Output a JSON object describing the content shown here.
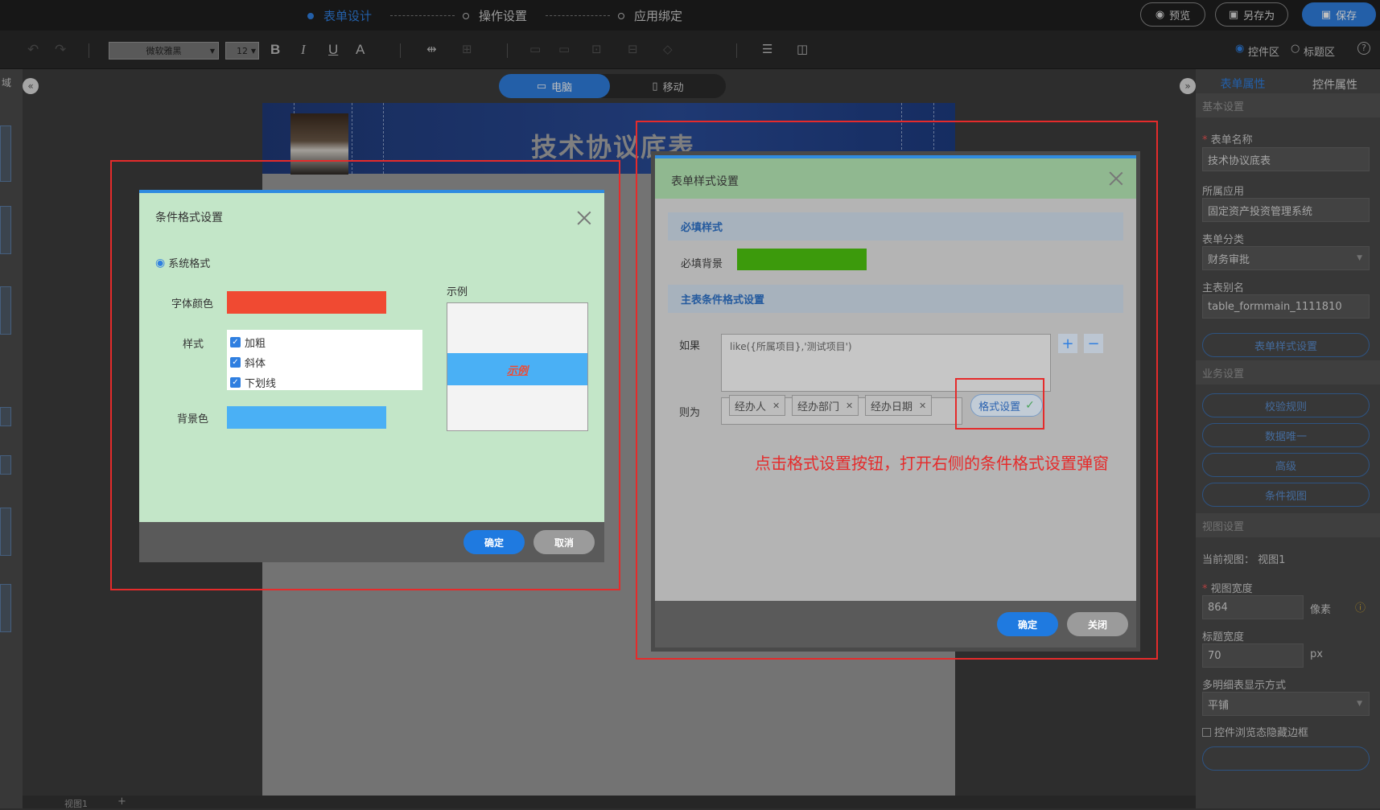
{
  "topbar": {
    "steps": [
      "表单设计",
      "操作设置",
      "应用绑定"
    ],
    "preview_label": "预览",
    "save_as_label": "另存为",
    "save_label": "保存"
  },
  "toolbar": {
    "font_family": "微软雅黑",
    "font_size": "12",
    "bold": "B",
    "italic": "I",
    "underline": "U",
    "font_color": "A",
    "control_area_label": "控件区",
    "title_area_label": "标题区",
    "help": "?"
  },
  "left_panel": {
    "label": "域"
  },
  "canvas": {
    "device_pc": "电脑",
    "device_mobile": "移动",
    "form_title": "技术协议底表",
    "bottom_view": "视图1",
    "add_view": "+"
  },
  "right_panel": {
    "tab_form": "表单属性",
    "tab_control": "控件属性",
    "section_basic": "基本设置",
    "form_name_label": "表单名称",
    "form_name_value": "技术协议底表",
    "app_label": "所属应用",
    "app_value": "固定资产投资管理系统",
    "category_label": "表单分类",
    "category_value": "财务审批",
    "alias_label": "主表别名",
    "alias_value": "table_formmain_1111810",
    "style_btn": "表单样式设置",
    "section_business": "业务设置",
    "btn_rules": "校验规则",
    "btn_unique": "数据唯一",
    "btn_advanced": "高级",
    "btn_cond_view": "条件视图",
    "section_view": "视图设置",
    "current_view_label": "当前视图：",
    "current_view_value": "视图1",
    "view_width_label": "视图宽度",
    "view_width_value": "864",
    "view_width_unit": "像素",
    "title_width_label": "标题宽度",
    "title_width_value": "70",
    "title_width_unit": "px",
    "multi_detail_label": "多明细表显示方式",
    "multi_detail_value": "平铺",
    "hide_border_label": "控件浏览态隐藏边框"
  },
  "cond_format_dialog": {
    "title": "条件格式设置",
    "radio_system": "系统格式",
    "font_color_label": "字体颜色",
    "font_color": "#f04a32",
    "style_label": "样式",
    "styles": [
      "加粗",
      "斜体",
      "下划线"
    ],
    "bg_color_label": "背景色",
    "bg_color": "#4ab0f5",
    "example_label": "示例",
    "example_text": "示例",
    "ok": "确定",
    "cancel": "取消"
  },
  "form_style_dialog": {
    "title": "表单样式设置",
    "required_section": "必填样式",
    "required_bg_label": "必填背景",
    "required_bg_color": "#3c9a0c",
    "main_cond_section": "主表条件格式设置",
    "if_label": "如果",
    "if_expression": "like({所属项目},'测试项目')",
    "then_label": "则为",
    "tags": [
      "经办人",
      "经办部门",
      "经办日期"
    ],
    "format_btn": "格式设置",
    "ok": "确定",
    "close": "关闭"
  },
  "annotation": {
    "text": "点击格式设置按钮，打开右侧的条件格式设置弹窗",
    "color": "#e52b2b"
  }
}
